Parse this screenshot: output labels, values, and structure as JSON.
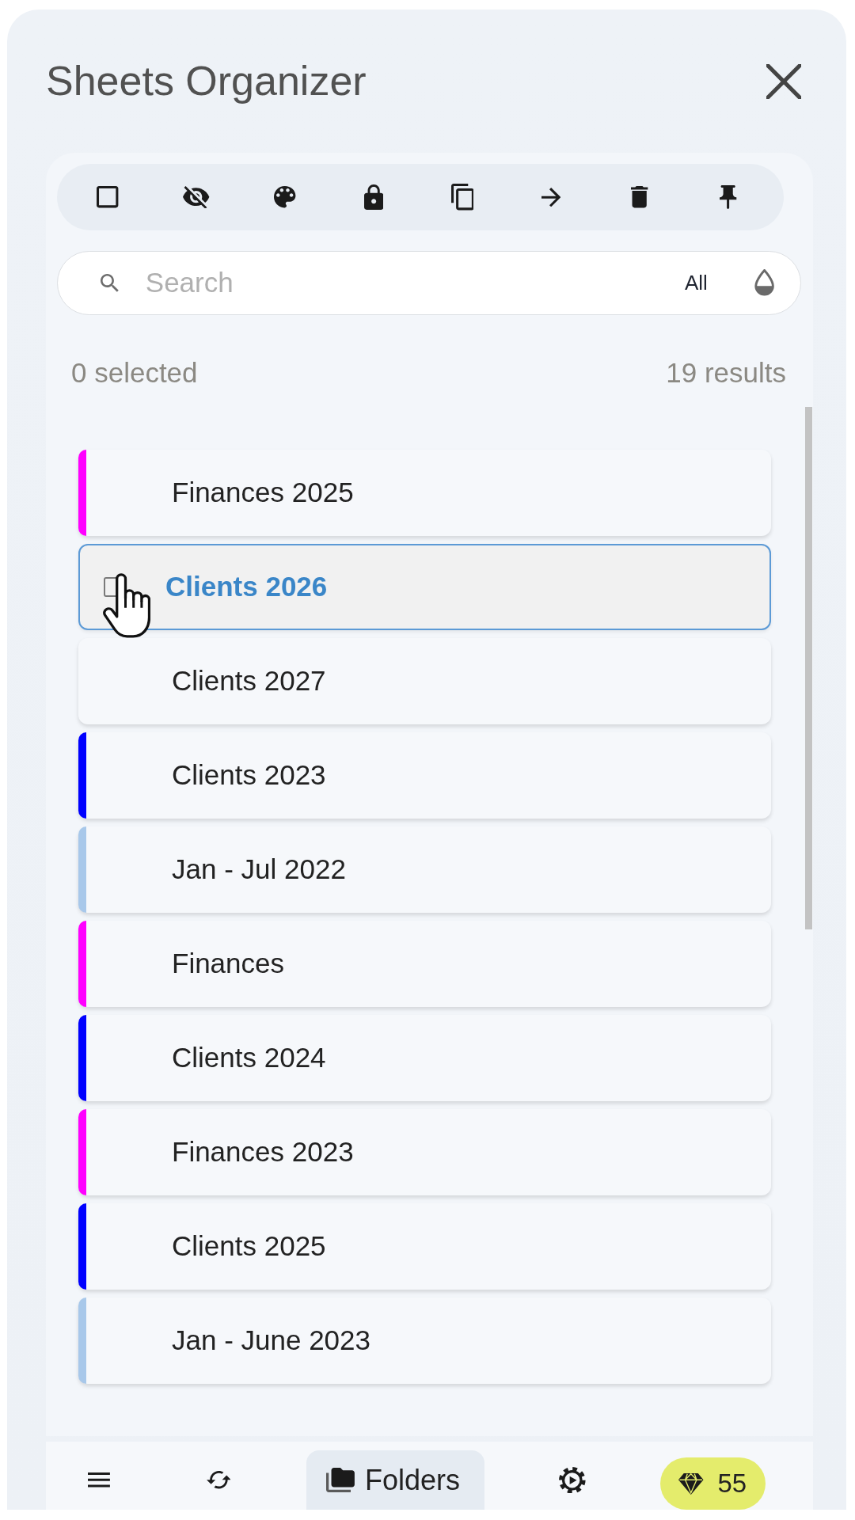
{
  "header": {
    "title": "Sheets Organizer"
  },
  "search": {
    "placeholder": "Search",
    "filter": "All"
  },
  "summary": {
    "selected": "0 selected",
    "results": "19 results"
  },
  "items": [
    {
      "label": "Finances 2025",
      "color": "#ff00ff",
      "hovered": false
    },
    {
      "label": "Clients 2026",
      "hovered": true
    },
    {
      "label": "Clients 2027",
      "hovered": false
    },
    {
      "label": "Clients 2023",
      "color": "#0000ff",
      "hovered": false
    },
    {
      "label": "Jan - Jul 2022",
      "color": "#a8c8ea",
      "hovered": false
    },
    {
      "label": "Finances",
      "color": "#ff00ff",
      "hovered": false
    },
    {
      "label": "Clients 2024",
      "color": "#0000ff",
      "hovered": false
    },
    {
      "label": "Finances 2023",
      "color": "#ff00ff",
      "hovered": false
    },
    {
      "label": "Clients 2025",
      "color": "#0000ff",
      "hovered": false
    },
    {
      "label": "Jan - June 2023",
      "color": "#a8c8ea",
      "hovered": false
    }
  ],
  "nav": [
    {
      "kind": "menu",
      "selected": false
    },
    {
      "kind": "refresh",
      "selected": false
    },
    {
      "kind": "folders",
      "label": "Folders",
      "selected": true
    },
    {
      "kind": "settings",
      "selected": false
    }
  ],
  "gems": {
    "count": "55"
  }
}
